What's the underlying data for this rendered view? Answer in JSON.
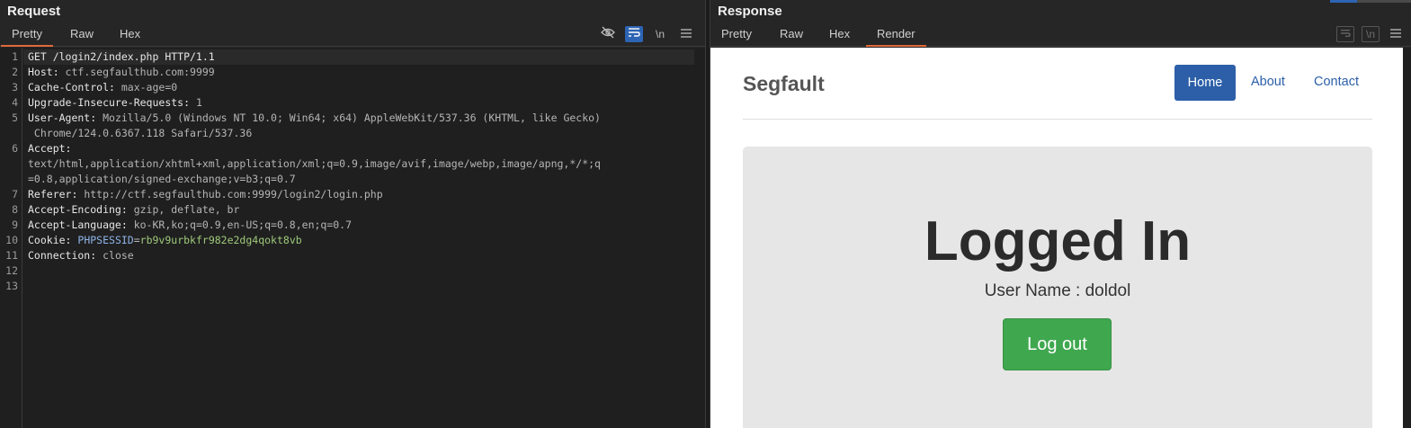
{
  "request": {
    "title": "Request",
    "tabs": [
      "Pretty",
      "Raw",
      "Hex"
    ],
    "active_tab": "Pretty",
    "toolbar": {
      "newline_label": "\\n"
    },
    "lines": [
      {
        "n": "1",
        "key": "GET /login2/index.php HTTP/1.1",
        "val": ""
      },
      {
        "n": "2",
        "key": "Host:",
        "val": " ctf.segfaulthub.com:9999"
      },
      {
        "n": "3",
        "key": "Cache-Control:",
        "val": " max-age=0"
      },
      {
        "n": "4",
        "key": "Upgrade-Insecure-Requests:",
        "val": " 1"
      },
      {
        "n": "5",
        "key": "User-Agent:",
        "val": " Mozilla/5.0 (Windows NT 10.0; Win64; x64) AppleWebKit/537.36 (KHTML, like Gecko)"
      },
      {
        "n": "",
        "key": "",
        "val": " Chrome/124.0.6367.118 Safari/537.36"
      },
      {
        "n": "6",
        "key": "Accept:",
        "val": ""
      },
      {
        "n": "",
        "key": "",
        "val": "text/html,application/xhtml+xml,application/xml;q=0.9,image/avif,image/webp,image/apng,*/*;q"
      },
      {
        "n": "",
        "key": "",
        "val": "=0.8,application/signed-exchange;v=b3;q=0.7"
      },
      {
        "n": "7",
        "key": "Referer:",
        "val": " http://ctf.segfaulthub.com:9999/login2/login.php"
      },
      {
        "n": "8",
        "key": "Accept-Encoding:",
        "val": " gzip, deflate, br"
      },
      {
        "n": "9",
        "key": "Accept-Language:",
        "val": " ko-KR,ko;q=0.9,en-US;q=0.8,en;q=0.7"
      },
      {
        "n": "10",
        "key": "Cookie:",
        "val": " ",
        "cookie_name": "PHPSESSID",
        "cookie_eq": "=",
        "cookie_val": "rb9v9urbkfr982e2dg4qokt8vb"
      },
      {
        "n": "11",
        "key": "Connection:",
        "val": " close"
      },
      {
        "n": "12",
        "key": "",
        "val": ""
      },
      {
        "n": "13",
        "key": "",
        "val": ""
      }
    ]
  },
  "response": {
    "title": "Response",
    "tabs": [
      "Pretty",
      "Raw",
      "Hex",
      "Render"
    ],
    "active_tab": "Render",
    "toolbar": {
      "newline_label": "\\n"
    },
    "page": {
      "brand": "Segfault",
      "nav": [
        "Home",
        "About",
        "Contact"
      ],
      "active_nav": "Home",
      "heading": "Logged In",
      "subtitle": "User Name : doldol",
      "button": "Log out"
    }
  },
  "colors": {
    "accent_tab": "#e2693a",
    "primary_blue": "#2c5fa8",
    "success_green": "#3fa84f",
    "cookie_key": "#8fb4e8",
    "cookie_value": "#9ec97a"
  }
}
